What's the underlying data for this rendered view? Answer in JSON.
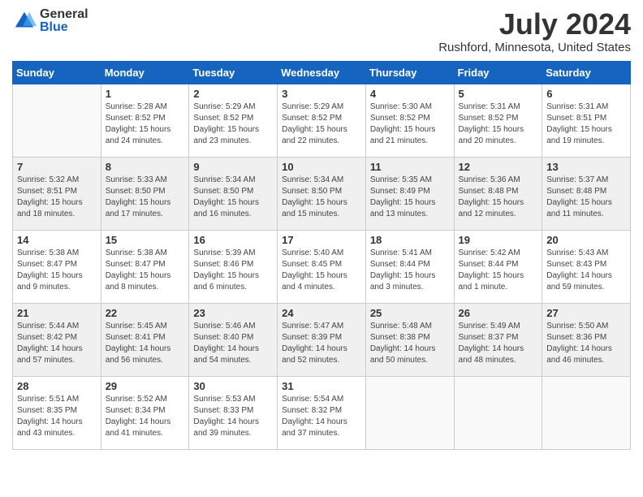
{
  "header": {
    "logo_general": "General",
    "logo_blue": "Blue",
    "month_title": "July 2024",
    "location": "Rushford, Minnesota, United States"
  },
  "days_of_week": [
    "Sunday",
    "Monday",
    "Tuesday",
    "Wednesday",
    "Thursday",
    "Friday",
    "Saturday"
  ],
  "weeks": [
    [
      {
        "num": "",
        "info": ""
      },
      {
        "num": "1",
        "info": "Sunrise: 5:28 AM\nSunset: 8:52 PM\nDaylight: 15 hours\nand 24 minutes."
      },
      {
        "num": "2",
        "info": "Sunrise: 5:29 AM\nSunset: 8:52 PM\nDaylight: 15 hours\nand 23 minutes."
      },
      {
        "num": "3",
        "info": "Sunrise: 5:29 AM\nSunset: 8:52 PM\nDaylight: 15 hours\nand 22 minutes."
      },
      {
        "num": "4",
        "info": "Sunrise: 5:30 AM\nSunset: 8:52 PM\nDaylight: 15 hours\nand 21 minutes."
      },
      {
        "num": "5",
        "info": "Sunrise: 5:31 AM\nSunset: 8:52 PM\nDaylight: 15 hours\nand 20 minutes."
      },
      {
        "num": "6",
        "info": "Sunrise: 5:31 AM\nSunset: 8:51 PM\nDaylight: 15 hours\nand 19 minutes."
      }
    ],
    [
      {
        "num": "7",
        "info": "Sunrise: 5:32 AM\nSunset: 8:51 PM\nDaylight: 15 hours\nand 18 minutes."
      },
      {
        "num": "8",
        "info": "Sunrise: 5:33 AM\nSunset: 8:50 PM\nDaylight: 15 hours\nand 17 minutes."
      },
      {
        "num": "9",
        "info": "Sunrise: 5:34 AM\nSunset: 8:50 PM\nDaylight: 15 hours\nand 16 minutes."
      },
      {
        "num": "10",
        "info": "Sunrise: 5:34 AM\nSunset: 8:50 PM\nDaylight: 15 hours\nand 15 minutes."
      },
      {
        "num": "11",
        "info": "Sunrise: 5:35 AM\nSunset: 8:49 PM\nDaylight: 15 hours\nand 13 minutes."
      },
      {
        "num": "12",
        "info": "Sunrise: 5:36 AM\nSunset: 8:48 PM\nDaylight: 15 hours\nand 12 minutes."
      },
      {
        "num": "13",
        "info": "Sunrise: 5:37 AM\nSunset: 8:48 PM\nDaylight: 15 hours\nand 11 minutes."
      }
    ],
    [
      {
        "num": "14",
        "info": "Sunrise: 5:38 AM\nSunset: 8:47 PM\nDaylight: 15 hours\nand 9 minutes."
      },
      {
        "num": "15",
        "info": "Sunrise: 5:38 AM\nSunset: 8:47 PM\nDaylight: 15 hours\nand 8 minutes."
      },
      {
        "num": "16",
        "info": "Sunrise: 5:39 AM\nSunset: 8:46 PM\nDaylight: 15 hours\nand 6 minutes."
      },
      {
        "num": "17",
        "info": "Sunrise: 5:40 AM\nSunset: 8:45 PM\nDaylight: 15 hours\nand 4 minutes."
      },
      {
        "num": "18",
        "info": "Sunrise: 5:41 AM\nSunset: 8:44 PM\nDaylight: 15 hours\nand 3 minutes."
      },
      {
        "num": "19",
        "info": "Sunrise: 5:42 AM\nSunset: 8:44 PM\nDaylight: 15 hours\nand 1 minute."
      },
      {
        "num": "20",
        "info": "Sunrise: 5:43 AM\nSunset: 8:43 PM\nDaylight: 14 hours\nand 59 minutes."
      }
    ],
    [
      {
        "num": "21",
        "info": "Sunrise: 5:44 AM\nSunset: 8:42 PM\nDaylight: 14 hours\nand 57 minutes."
      },
      {
        "num": "22",
        "info": "Sunrise: 5:45 AM\nSunset: 8:41 PM\nDaylight: 14 hours\nand 56 minutes."
      },
      {
        "num": "23",
        "info": "Sunrise: 5:46 AM\nSunset: 8:40 PM\nDaylight: 14 hours\nand 54 minutes."
      },
      {
        "num": "24",
        "info": "Sunrise: 5:47 AM\nSunset: 8:39 PM\nDaylight: 14 hours\nand 52 minutes."
      },
      {
        "num": "25",
        "info": "Sunrise: 5:48 AM\nSunset: 8:38 PM\nDaylight: 14 hours\nand 50 minutes."
      },
      {
        "num": "26",
        "info": "Sunrise: 5:49 AM\nSunset: 8:37 PM\nDaylight: 14 hours\nand 48 minutes."
      },
      {
        "num": "27",
        "info": "Sunrise: 5:50 AM\nSunset: 8:36 PM\nDaylight: 14 hours\nand 46 minutes."
      }
    ],
    [
      {
        "num": "28",
        "info": "Sunrise: 5:51 AM\nSunset: 8:35 PM\nDaylight: 14 hours\nand 43 minutes."
      },
      {
        "num": "29",
        "info": "Sunrise: 5:52 AM\nSunset: 8:34 PM\nDaylight: 14 hours\nand 41 minutes."
      },
      {
        "num": "30",
        "info": "Sunrise: 5:53 AM\nSunset: 8:33 PM\nDaylight: 14 hours\nand 39 minutes."
      },
      {
        "num": "31",
        "info": "Sunrise: 5:54 AM\nSunset: 8:32 PM\nDaylight: 14 hours\nand 37 minutes."
      },
      {
        "num": "",
        "info": ""
      },
      {
        "num": "",
        "info": ""
      },
      {
        "num": "",
        "info": ""
      }
    ]
  ]
}
